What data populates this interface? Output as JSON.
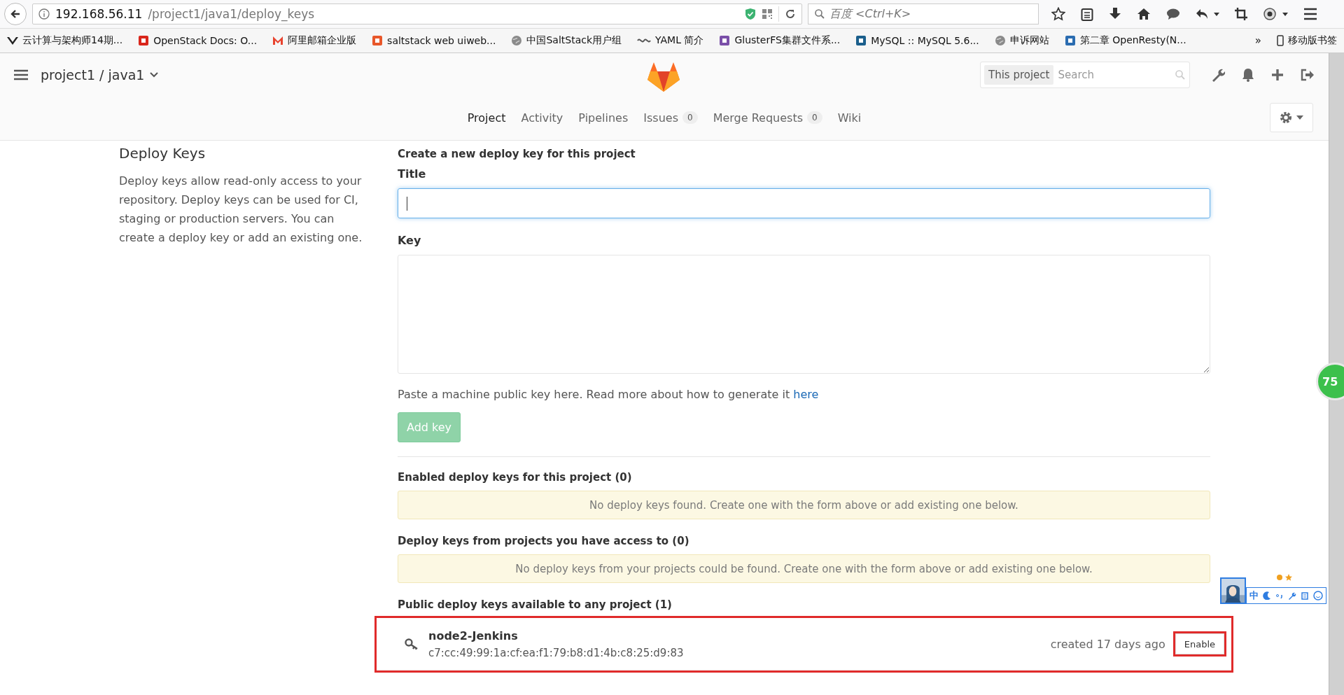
{
  "browser": {
    "url_host": "192.168.56.11",
    "url_path": "/project1/java1/deploy_keys",
    "search_placeholder": "百度 <Ctrl+K>",
    "bookmarks": [
      {
        "label": "云计算与架构师14期...",
        "kind": "v",
        "color": "#222222"
      },
      {
        "label": "OpenStack Docs: O...",
        "kind": "square",
        "color": "#d9261c"
      },
      {
        "label": "阿里邮箱企业版",
        "kind": "m",
        "color": "#e8432e"
      },
      {
        "label": "saltstack web uiweb...",
        "kind": "square",
        "color": "#e8572a"
      },
      {
        "label": "中国SaltStack用户组",
        "kind": "globe",
        "color": "#8a8a8a"
      },
      {
        "label": "YAML 简介",
        "kind": "glyph",
        "color": "#555555"
      },
      {
        "label": "GlusterFS集群文件系...",
        "kind": "square",
        "color": "#7a4fa8"
      },
      {
        "label": "MySQL :: MySQL 5.6...",
        "kind": "square",
        "color": "#1b5f8c"
      },
      {
        "label": "申诉网站",
        "kind": "globe",
        "color": "#8a8a8a"
      },
      {
        "label": "第二章 OpenResty(N...",
        "kind": "square",
        "color": "#2b6cb0"
      }
    ],
    "more": "»",
    "mobile_bookmarks": "移动版书签"
  },
  "header": {
    "project": "project1 / java1",
    "search_scope": "This project",
    "search_placeholder": "Search",
    "tabs": [
      {
        "label": "Project",
        "selected": true
      },
      {
        "label": "Activity",
        "selected": false
      },
      {
        "label": "Pipelines",
        "selected": false
      },
      {
        "label": "Issues",
        "selected": false,
        "count": "0"
      },
      {
        "label": "Merge Requests",
        "selected": false,
        "count": "0"
      },
      {
        "label": "Wiki",
        "selected": false
      }
    ]
  },
  "sidebar": {
    "title": "Deploy Keys",
    "description": "Deploy keys allow read-only access to your repository. Deploy keys can be used for CI, staging or production servers. You can create a deploy key or add an existing one."
  },
  "form": {
    "heading": "Create a new deploy key for this project",
    "title_label": "Title",
    "key_label": "Key",
    "hint": "Paste a machine public key here. Read more about how to generate it",
    "hint_link": "here",
    "submit": "Add key",
    "submit_disabled": true
  },
  "sections": [
    {
      "heading": "Enabled deploy keys for this project (0)",
      "notice": "No deploy keys found. Create one with the form above or add existing one below."
    },
    {
      "heading": "Deploy keys from projects you have access to (0)",
      "notice": "No deploy keys from your projects could be found. Create one with the form above or add existing one below."
    }
  ],
  "public_keys": {
    "heading": "Public deploy keys available to any project (1)",
    "keys": [
      {
        "name": "node2-Jenkins",
        "fingerprint": "c7:cc:49:99:1a:cf:ea:f1:79:b8:d1:4b:c8:25:d9:83",
        "created": "created 17 days ago",
        "action": "Enable",
        "highlighted": true
      }
    ]
  },
  "overlays": {
    "badge": "75",
    "ime_mode": "中"
  }
}
